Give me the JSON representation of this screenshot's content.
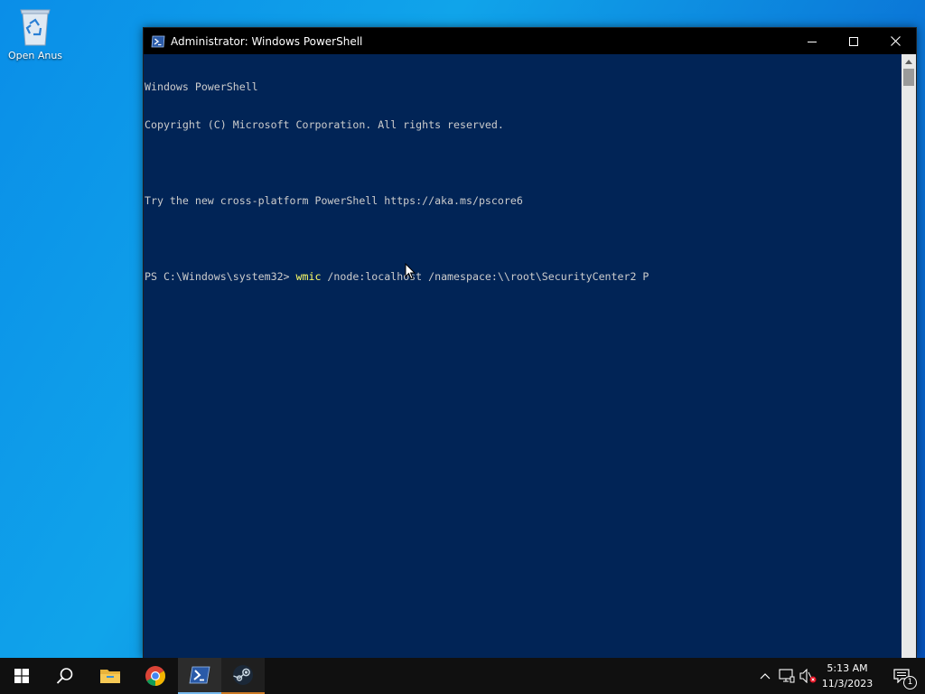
{
  "desktop": {
    "icons": [
      {
        "label": "Open Anus",
        "icon": "recycle-bin-icon"
      }
    ]
  },
  "window": {
    "title": "Administrator: Windows PowerShell",
    "icon": "powershell-icon",
    "controls": [
      "minimize-icon",
      "maximize-icon",
      "close-icon"
    ]
  },
  "console": {
    "background": "#012456",
    "text_color": "#cccccc",
    "command_color": "#ffff66",
    "lines": [
      "Windows PowerShell",
      "Copyright (C) Microsoft Corporation. All rights reserved.",
      "",
      "Try the new cross-platform PowerShell https://aka.ms/pscore6",
      ""
    ],
    "prompt": "PS C:\\Windows\\system32> ",
    "command": "wmic",
    "arguments": " /node:localhost /namespace:\\\\root\\SecurityCenter2 P"
  },
  "taskbar": {
    "items": [
      {
        "name": "start",
        "icon": "windows-logo-icon"
      },
      {
        "name": "search",
        "icon": "search-icon"
      },
      {
        "name": "file-explorer",
        "icon": "folder-icon"
      },
      {
        "name": "chrome",
        "icon": "chrome-icon"
      },
      {
        "name": "powershell",
        "icon": "powershell-icon",
        "state": "active"
      },
      {
        "name": "steam",
        "icon": "steam-icon",
        "state": "running"
      }
    ],
    "tray": {
      "icons": [
        "chevron-up-icon",
        "network-icon",
        "volume-muted-icon"
      ],
      "time": "5:13 AM",
      "date": "11/3/2023",
      "notification_count": "1"
    }
  }
}
